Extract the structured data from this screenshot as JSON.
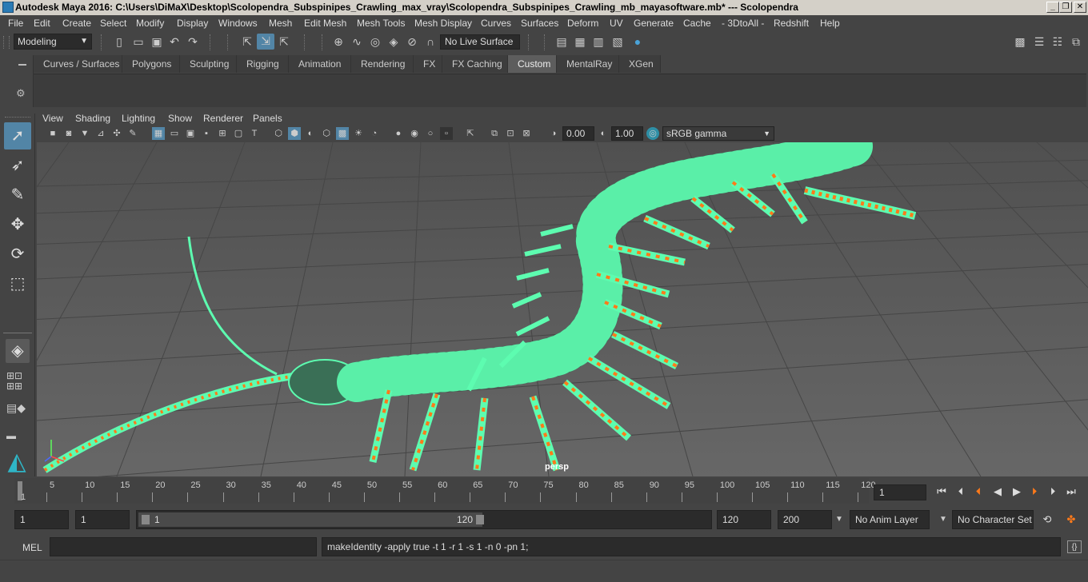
{
  "window": {
    "title": "Autodesk Maya 2016: C:\\Users\\DiMaX\\Desktop\\Scolopendra_Subspinipes_Crawling_max_vray\\Scolopendra_Subspinipes_Crawling_mb_mayasoftware.mb*   ---   Scolopendra",
    "minimize_glyph": "_",
    "maximize_glyph": "❐",
    "close_glyph": "✕"
  },
  "menubar": {
    "items": [
      "File",
      "Edit",
      "Create",
      "Select",
      "Modify",
      "Display",
      "Windows",
      "Mesh",
      "Edit Mesh",
      "Mesh Tools",
      "Mesh Display",
      "Curves",
      "Surfaces",
      "Deform",
      "UV",
      "Generate",
      "Cache",
      "- 3DtoAll -",
      "Redshift",
      "Help"
    ]
  },
  "statusline": {
    "mode": "Modeling",
    "live_surface": "No Live Surface"
  },
  "shelf": {
    "tabs": [
      "Curves / Surfaces",
      "Polygons",
      "Sculpting",
      "Rigging",
      "Animation",
      "Rendering",
      "FX",
      "FX Caching",
      "Custom",
      "MentalRay",
      "XGen"
    ],
    "active_tab": "Custom"
  },
  "toolbox": {
    "tools": [
      "select-tool-icon",
      "lasso-tool-icon",
      "paint-select-icon",
      "move-tool-icon",
      "rotate-tool-icon",
      "scale-tool-icon"
    ]
  },
  "panel": {
    "menus": [
      "View",
      "Shading",
      "Lighting",
      "Show",
      "Renderer",
      "Panels"
    ],
    "exposure": "0.00",
    "gamma": "1.00",
    "color_space": "sRGB gamma",
    "camera_label": "persp"
  },
  "timeslider": {
    "ticks": [
      "5",
      "10",
      "15",
      "20",
      "25",
      "30",
      "35",
      "40",
      "45",
      "50",
      "55",
      "60",
      "65",
      "70",
      "75",
      "80",
      "85",
      "90",
      "95",
      "100",
      "105",
      "110",
      "115",
      "120"
    ],
    "start_marker": "1",
    "current_frame": "1"
  },
  "range": {
    "start_time": "1",
    "playback_start": "1",
    "range_start_label": "1",
    "range_end_label": "120",
    "playback_end": "120",
    "end_time": "200",
    "anim_layer": "No Anim Layer",
    "character_set": "No Character Set"
  },
  "cmdline": {
    "language": "MEL",
    "input": "",
    "result": "makeIdentity -apply true -t 1 -r 1 -s 1 -n 0 -pn 1;"
  },
  "colors": {
    "wireframe": "#5dfcb0",
    "orange_highlight": "#ff7a1a",
    "active_blue": "#5285a6",
    "viewport_bg": "#5b5b5b"
  }
}
